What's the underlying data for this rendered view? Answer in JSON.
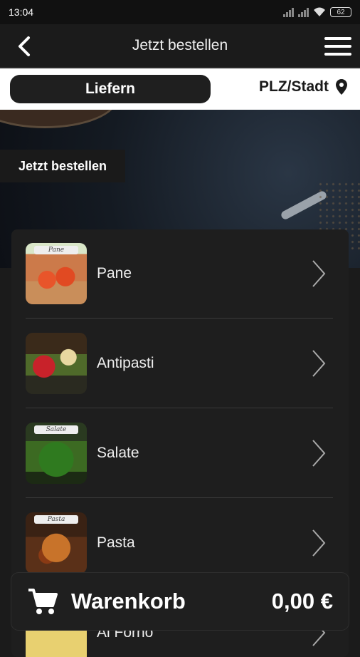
{
  "status_bar": {
    "time": "13:04",
    "battery": "62"
  },
  "header": {
    "title": "Jetzt bestellen"
  },
  "delivery": {
    "mode_label": "Liefern",
    "location_label": "PLZ/Stadt"
  },
  "hero": {
    "cta_label": "Jetzt bestellen"
  },
  "menu": {
    "items": [
      {
        "label": "Pane",
        "image_tag": "Pane"
      },
      {
        "label": "Antipasti",
        "image_tag": ""
      },
      {
        "label": "Salate",
        "image_tag": "Salate"
      },
      {
        "label": "Pasta",
        "image_tag": "Pasta"
      },
      {
        "label": "Al Forno",
        "image_tag": ""
      }
    ]
  },
  "cart": {
    "label": "Warenkorb",
    "total": "0,00 €"
  },
  "colors": {
    "background": "#1b1b1b",
    "card": "#1e1e1e",
    "toggle": "#1f1f1f",
    "white_bar": "#ffffff"
  }
}
